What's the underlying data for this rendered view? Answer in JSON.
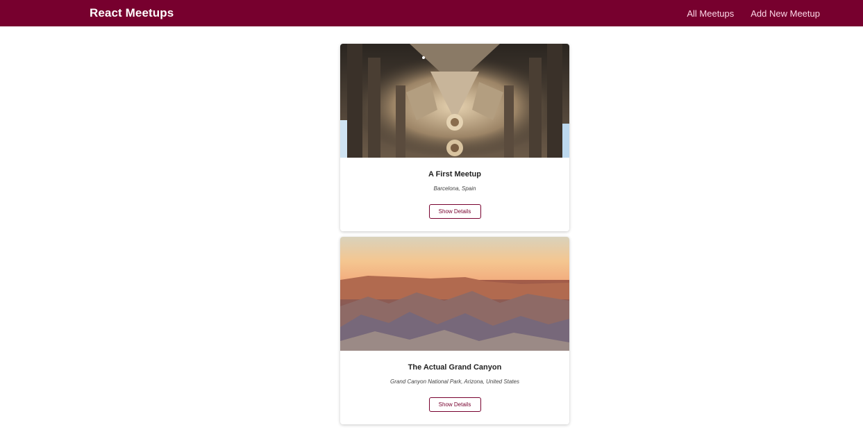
{
  "header": {
    "logo": "React Meetups",
    "nav": [
      "All Meetups",
      "Add New Meetup"
    ],
    "background": "#77002e"
  },
  "meetups": [
    {
      "title": "A First Meetup",
      "address": "Barcelona, Spain",
      "button": "Show Details",
      "image_subject": "cathedral interior ceiling"
    },
    {
      "title": "The Actual Grand Canyon",
      "address": "Grand Canyon National Park, Arizona, United States",
      "button": "Show Details",
      "image_subject": "grand canyon at sunset"
    }
  ]
}
